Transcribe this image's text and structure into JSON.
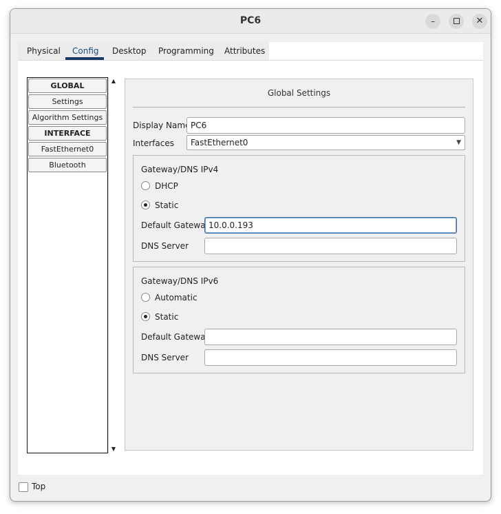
{
  "window": {
    "title": "PC6"
  },
  "window_controls": {
    "minimize": "–",
    "close": "✕"
  },
  "tabs": [
    {
      "label": "Physical"
    },
    {
      "label": "Config",
      "active": true
    },
    {
      "label": "Desktop"
    },
    {
      "label": "Programming"
    },
    {
      "label": "Attributes"
    }
  ],
  "sidebar": {
    "items": [
      {
        "label": "GLOBAL",
        "type": "header"
      },
      {
        "label": "Settings",
        "type": "item"
      },
      {
        "label": "Algorithm Settings",
        "type": "item"
      },
      {
        "label": "INTERFACE",
        "type": "header"
      },
      {
        "label": "FastEthernet0",
        "type": "item"
      },
      {
        "label": "Bluetooth",
        "type": "item"
      }
    ],
    "scroll_up": "▲",
    "scroll_down": "▼"
  },
  "panel": {
    "title": "Global Settings",
    "display_name_label": "Display Name",
    "display_name_value": "PC6",
    "interfaces_label": "Interfaces",
    "interfaces_value": "FastEthernet0",
    "ipv4": {
      "title": "Gateway/DNS IPv4",
      "option_dynamic": "DHCP",
      "option_static": "Static",
      "selected": "Static",
      "gateway_label": "Default Gateway",
      "gateway_value": "10.0.0.193",
      "dns_label": "DNS Server",
      "dns_value": ""
    },
    "ipv6": {
      "title": "Gateway/DNS IPv6",
      "option_dynamic": "Automatic",
      "option_static": "Static",
      "selected": "Static",
      "gateway_label": "Default Gateway",
      "gateway_value": "",
      "dns_label": "DNS Server",
      "dns_value": ""
    }
  },
  "footer": {
    "top_label": "Top",
    "top_checked": false
  },
  "colors": {
    "active_tab_underline": "#1a3866",
    "focus_border": "#3a6ea5"
  }
}
